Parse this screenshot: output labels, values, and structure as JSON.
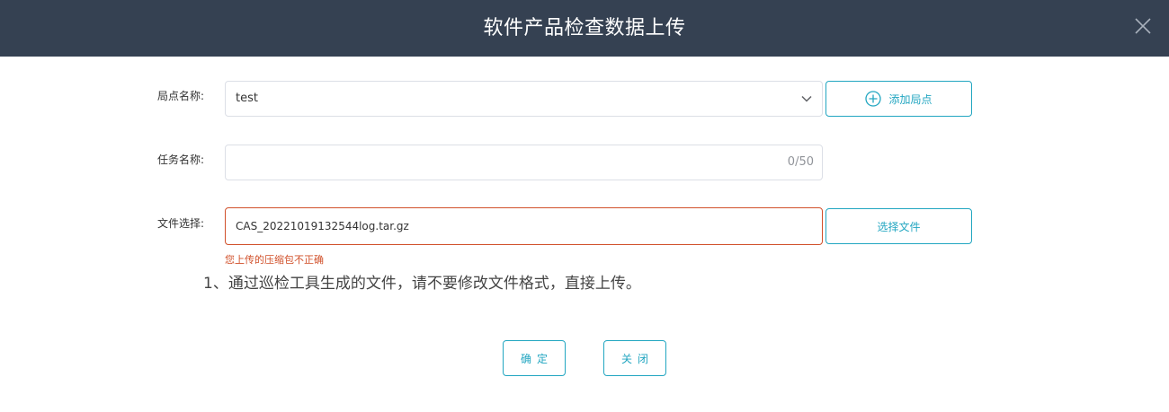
{
  "dialog": {
    "title": "软件产品检查数据上传",
    "close_icon": "close-icon"
  },
  "form": {
    "site": {
      "label": "局点名称:",
      "value": "test",
      "add_button_label": "添加局点",
      "add_icon": "plus-circle-icon"
    },
    "task": {
      "label": "任务名称:",
      "value": "",
      "counter": "0/50"
    },
    "file": {
      "label": "文件选择:",
      "value": "CAS_20221019132544log.tar.gz",
      "choose_button_label": "选择文件",
      "error": "您上传的压缩包不正确"
    },
    "hint": "1、通过巡检工具生成的文件，请不要修改文件格式，直接上传。"
  },
  "footer": {
    "ok_label": "确定",
    "close_label": "关闭"
  },
  "colors": {
    "header_bg": "#354152",
    "accent": "#22a6c1",
    "error": "#d1502a"
  }
}
